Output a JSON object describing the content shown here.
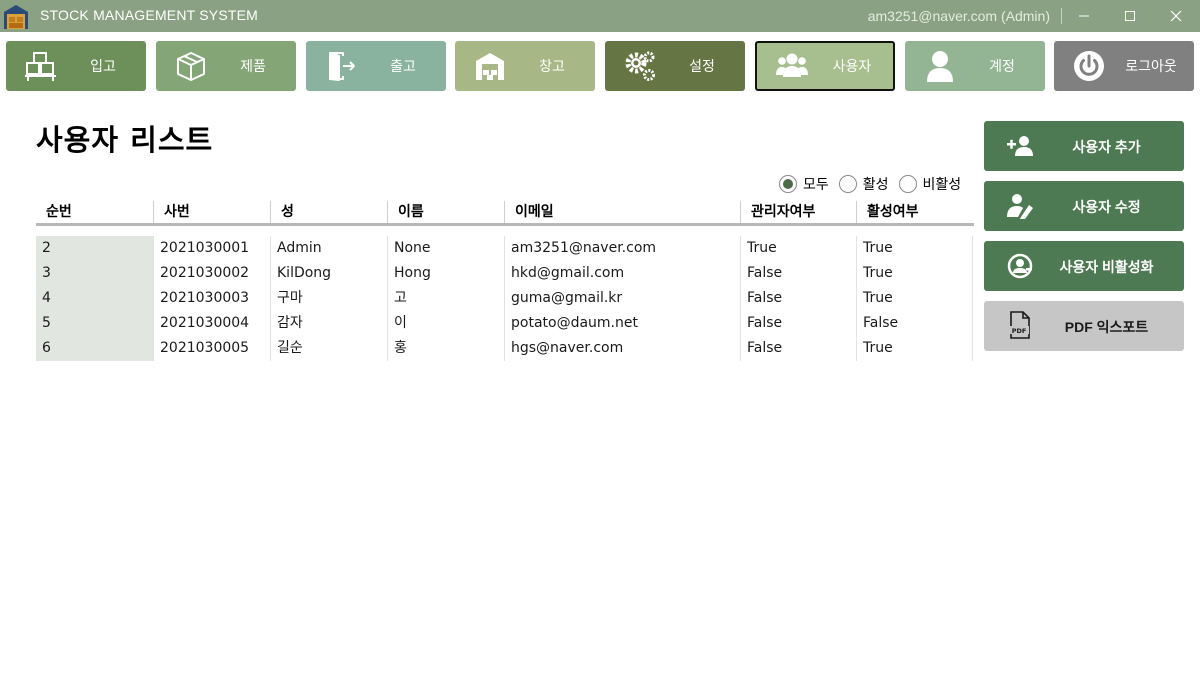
{
  "window": {
    "title": "STOCK MANAGEMENT SYSTEM",
    "user": "am3251@naver.com (Admin)"
  },
  "nav": [
    {
      "key": "inbound",
      "label": "입고",
      "icon": "boxes-icon",
      "color": "#6d8f5a"
    },
    {
      "key": "product",
      "label": "제품",
      "icon": "box-icon",
      "color": "#84a677"
    },
    {
      "key": "outbound",
      "label": "출고",
      "icon": "exit-icon",
      "color": "#8ab39f"
    },
    {
      "key": "warehouse",
      "label": "창고",
      "icon": "warehouse-icon",
      "color": "#a8b786"
    },
    {
      "key": "settings",
      "label": "설정",
      "icon": "gears-icon",
      "color": "#667544"
    },
    {
      "key": "users",
      "label": "사용자",
      "icon": "users-icon",
      "color": "#a7bf8f",
      "active": true
    },
    {
      "key": "account",
      "label": "계정",
      "icon": "user-icon",
      "color": "#93b594"
    },
    {
      "key": "logout",
      "label": "로그아웃",
      "icon": "power-icon",
      "color": "#808080"
    }
  ],
  "page": {
    "title": "사용자 리스트"
  },
  "filter": {
    "options": [
      "모두",
      "활성",
      "비활성"
    ],
    "selected": "모두"
  },
  "table": {
    "columns": [
      "순번",
      "사번",
      "성",
      "이름",
      "이메일",
      "관리자여부",
      "활성여부"
    ],
    "rows": [
      [
        "2",
        "2021030001",
        "Admin",
        "None",
        "am3251@naver.com",
        "True",
        "True"
      ],
      [
        "3",
        "2021030002",
        "KilDong",
        "Hong",
        "hkd@gmail.com",
        "False",
        "True"
      ],
      [
        "4",
        "2021030003",
        "구마",
        "고",
        "guma@gmail.kr",
        "False",
        "True"
      ],
      [
        "5",
        "2021030004",
        "감자",
        "이",
        "potato@daum.net",
        "False",
        "False"
      ],
      [
        "6",
        "2021030005",
        "길순",
        "홍",
        "hgs@naver.com",
        "False",
        "True"
      ]
    ]
  },
  "actions": {
    "add_user": "사용자 추가",
    "edit_user": "사용자 수정",
    "deactivate_user": "사용자 비활성화",
    "export_pdf": "PDF 익스포트",
    "pdf_icon_text": "PDF"
  },
  "colors": {
    "titlebar": "#8aa183",
    "action_green": "#4d7a52",
    "export_gray": "#c6c6c6"
  }
}
